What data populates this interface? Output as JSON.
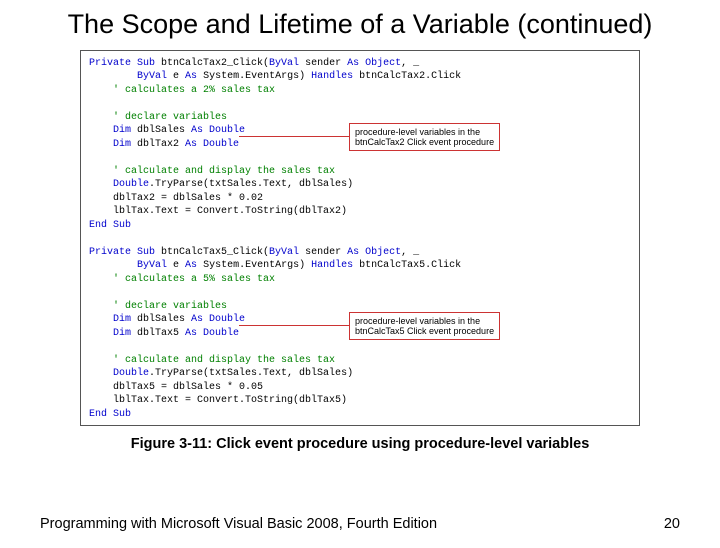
{
  "title": "The Scope and Lifetime of a Variable (continued)",
  "code": {
    "p1_l1a": "Private Sub",
    "p1_l1b": " btnCalcTax2_Click(",
    "p1_l1c": "ByVal",
    "p1_l1d": " sender ",
    "p1_l1e": "As Object",
    "p1_l1f": ", _",
    "p1_l2a": "        ",
    "p1_l2b": "ByVal",
    "p1_l2c": " e ",
    "p1_l2d": "As",
    "p1_l2e": " System.EventArgs) ",
    "p1_l2f": "Handles",
    "p1_l2g": " btnCalcTax2.Click",
    "p1_c1": "    ' calculates a 2% sales tax",
    "blank": " ",
    "p1_c2": "    ' declare variables",
    "p1_d1a": "    ",
    "p1_d1b": "Dim",
    "p1_d1c": " dblSales ",
    "p1_d1d": "As Double",
    "p1_d2a": "    ",
    "p1_d2b": "Dim",
    "p1_d2c": " dblTax2 ",
    "p1_d2d": "As Double",
    "p1_c3": "    ' calculate and display the sales tax",
    "p1_s1a": "    ",
    "p1_s1b": "Double",
    "p1_s1c": ".TryParse(txtSales.Text, dblSales)",
    "p1_s2": "    dblTax2 = dblSales * 0.02",
    "p1_s3": "    lblTax.Text = Convert.ToString(dblTax2)",
    "p1_end": "End Sub",
    "p2_l1a": "Private Sub",
    "p2_l1b": " btnCalcTax5_Click(",
    "p2_l1c": "ByVal",
    "p2_l1d": " sender ",
    "p2_l1e": "As Object",
    "p2_l1f": ", _",
    "p2_l2a": "        ",
    "p2_l2b": "ByVal",
    "p2_l2c": " e ",
    "p2_l2d": "As",
    "p2_l2e": " System.EventArgs) ",
    "p2_l2f": "Handles",
    "p2_l2g": " btnCalcTax5.Click",
    "p2_c1": "    ' calculates a 5% sales tax",
    "p2_c2": "    ' declare variables",
    "p2_d1a": "    ",
    "p2_d1b": "Dim",
    "p2_d1c": " dblSales ",
    "p2_d1d": "As Double",
    "p2_d2a": "    ",
    "p2_d2b": "Dim",
    "p2_d2c": " dblTax5 ",
    "p2_d2d": "As Double",
    "p2_c3": "    ' calculate and display the sales tax",
    "p2_s1a": "    ",
    "p2_s1b": "Double",
    "p2_s1c": ".TryParse(txtSales.Text, dblSales)",
    "p2_s2": "    dblTax5 = dblSales * 0.05",
    "p2_s3": "    lblTax.Text = Convert.ToString(dblTax5)",
    "p2_end": "End Sub"
  },
  "callout1_l1": "procedure-level variables in the",
  "callout1_l2": "btnCalcTax2 Click event procedure",
  "callout2_l1": "procedure-level variables in the",
  "callout2_l2": "btnCalcTax5 Click event procedure",
  "figcaption": "Figure 3-11: Click event procedure using procedure-level variables",
  "footer_left": "Programming with Microsoft Visual Basic 2008, Fourth Edition",
  "footer_right": "20"
}
